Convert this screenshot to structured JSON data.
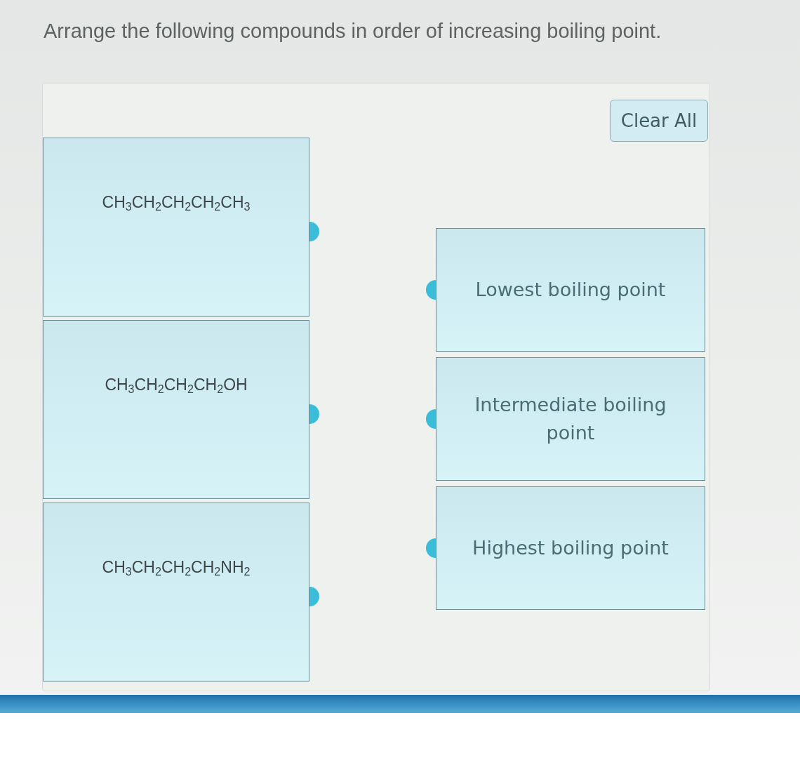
{
  "question": "Arrange the following compounds in order of increasing boiling point.",
  "clear_button": "Clear All",
  "compounds": [
    {
      "formula": "CH$_{3}$CH$_{2}$CH$_{2}$CH$_{2}$CH$_{3}$"
    },
    {
      "formula": "CH$_{3}$CH$_{2}$CH$_{2}$CH$_{2}$OH"
    },
    {
      "formula": "CH$_{3}$CH$_{2}$CH$_{2}$CH$_{2}$NH$_{2}$"
    }
  ],
  "targets": [
    {
      "label": "Lowest boiling point"
    },
    {
      "label": "Intermediate boiling point"
    },
    {
      "label": "Highest boiling point"
    }
  ]
}
